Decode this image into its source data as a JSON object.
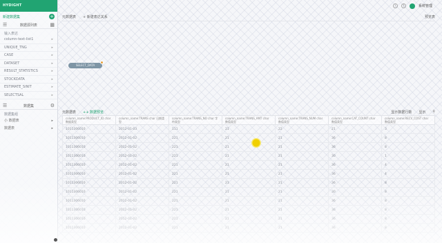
{
  "app": {
    "logo": "HYDIGHT"
  },
  "sidebar": {
    "create_label": "新建数据集",
    "datasource_title": "数据源列表",
    "input_group": "输入表达",
    "items": [
      {
        "label": "column-text-list1"
      },
      {
        "label": "UNIQUE_TNG"
      },
      {
        "label": "CASE"
      },
      {
        "label": "DATASET"
      },
      {
        "label": "RESULT_STATISTICS"
      },
      {
        "label": "STOCKDATA"
      },
      {
        "label": "ESTIMATE_SINIT"
      },
      {
        "label": "SELECTSAL"
      }
    ],
    "dataset_title": "数据集",
    "dataset_group": "数据集组",
    "dataset_items": [
      {
        "label": "小 数据表"
      },
      {
        "label": "数据表"
      }
    ]
  },
  "topbar": {
    "user": "系统管理"
  },
  "canvas": {
    "crumbs": [
      "元数据表",
      "+ 新建表达关系"
    ],
    "right": "预览表",
    "node_label": "SELECT_DATA"
  },
  "results": {
    "tabs": [
      "元数据表",
      "++ 数据预览"
    ],
    "actions": [
      "显示数据行数",
      "显示"
    ]
  },
  "table": {
    "headers": [
      "column_name:PRODUCT_ID char 数据类型",
      "column_name:TRANS char 日期类型",
      "column_name:TRANS_NO char 字符类型",
      "column_name:TRANS_AMT char 数值类型",
      "column_name:TRANS_NUM char 数值类型",
      "column_name:CAT_COUNT char 数值类型",
      "column_name:RECV_COST char 数值类型"
    ],
    "rows": [
      [
        "1011306010",
        "2012-01-03",
        "111",
        "21",
        "22",
        "21",
        "3"
      ],
      [
        "1011306010",
        "2012-01-02",
        "221",
        "21",
        "21",
        "36",
        "8"
      ],
      [
        "1011306010",
        "2012-01-02",
        "221",
        "21",
        "21",
        "36",
        "8"
      ],
      [
        "1011306010",
        "2012-01-02",
        "221",
        "21",
        "21",
        "30",
        "1"
      ],
      [
        "1011306010",
        "2012-01-02",
        "221",
        "21",
        "21",
        "36",
        "4"
      ],
      [
        "1011306010",
        "2012-01-02",
        "221",
        "21",
        "21",
        "36",
        "4"
      ],
      [
        "1011306010",
        "2012-01-02",
        "221",
        "21",
        "21",
        "36",
        "8"
      ],
      [
        "1011306010",
        "2012-01-02",
        "221",
        "21",
        "21",
        "30",
        "8"
      ],
      [
        "1011306010",
        "2012-01-02",
        "221",
        "21",
        "21",
        "36",
        "8"
      ],
      [
        "1011306010",
        "2012-01-02",
        "221",
        "21",
        "21",
        "36",
        "8"
      ],
      [
        "1011306010",
        "2012-01-02",
        "221",
        "21",
        "21",
        "36",
        "8"
      ],
      [
        "1011306010",
        "2012-01-02",
        "221",
        "21",
        "21",
        "36",
        "8"
      ]
    ]
  }
}
